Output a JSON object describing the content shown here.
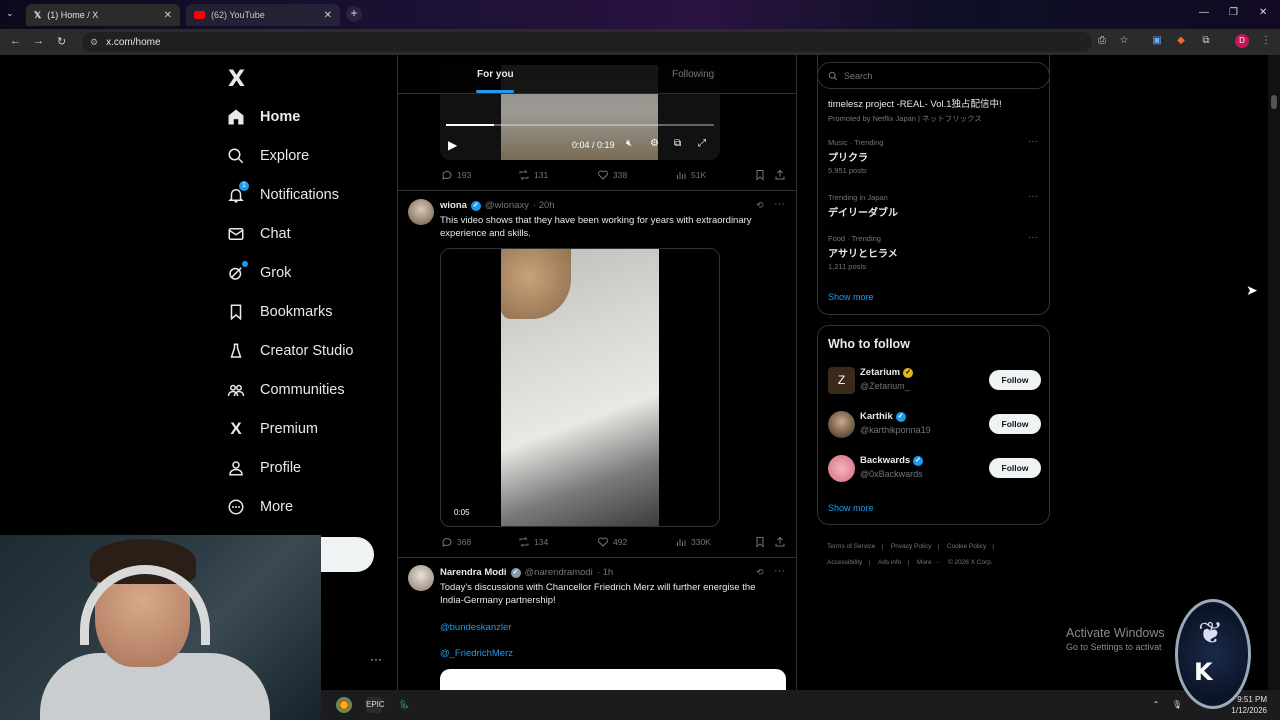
{
  "browser": {
    "tabs": [
      {
        "label": "(1) Home / X",
        "active": true,
        "icon": "x-logo-icon"
      },
      {
        "label": "(62) YouTube",
        "active": false,
        "icon": "youtube-icon"
      }
    ],
    "url": "x.com/home"
  },
  "nav": {
    "logo": "X",
    "items": [
      {
        "label": "Home",
        "icon": "home-icon",
        "bold": true
      },
      {
        "label": "Explore",
        "icon": "search-icon"
      },
      {
        "label": "Notifications",
        "icon": "bell-icon",
        "badge": "1"
      },
      {
        "label": "Chat",
        "icon": "mail-icon"
      },
      {
        "label": "Grok",
        "icon": "grok-icon"
      },
      {
        "label": "Bookmarks",
        "icon": "bookmark-icon"
      },
      {
        "label": "Creator Studio",
        "icon": "creator-icon"
      },
      {
        "label": "Communities",
        "icon": "communities-icon"
      },
      {
        "label": "Premium",
        "icon": "x-premium-icon"
      },
      {
        "label": "Profile",
        "icon": "person-icon"
      },
      {
        "label": "More",
        "icon": "more-circle-icon"
      }
    ]
  },
  "feed": {
    "tabs": {
      "for_you": "For you",
      "following": "Following"
    },
    "post0": {
      "time_display": "0:04 / 0:19",
      "replies": "193",
      "reposts": "131",
      "likes": "338",
      "views": "51K"
    },
    "post1": {
      "name": "wiona",
      "handle": "@wionaxy",
      "time": "· 20h",
      "text": "This video shows that they have been working for years with extraordinary experience and skills.",
      "video_time": "0:05",
      "replies": "368",
      "reposts": "134",
      "likes": "492",
      "views": "330K"
    },
    "post2": {
      "name": "Narendra Modi",
      "handle": "@narendramodi",
      "time": "· 1h",
      "text": "Today's discussions with Chancellor Friedrich Merz will further energise the India-Germany partnership!",
      "mention1": "@bundeskanzler",
      "mention2": "@_FriedrichMerz"
    }
  },
  "right": {
    "search_placeholder": "Search",
    "promo": {
      "title": "timelesz project -REAL- Vol.1独占配信中!",
      "meta": "Promoted by Netflix Japan | ネットフリックス"
    },
    "trends": [
      {
        "meta": "Music · Trending",
        "title": "プリクラ",
        "posts": "5,951 posts"
      },
      {
        "meta": "Trending in Japan",
        "title": "デイリーダブル",
        "posts": ""
      },
      {
        "meta": "Food · Trending",
        "title": "アサリとヒラメ",
        "posts": "1,211 posts"
      }
    ],
    "show_more": "Show more",
    "who_to_follow": {
      "title": "Who to follow",
      "accounts": [
        {
          "name": "Zetarium",
          "handle": "@Zetarium_",
          "verified": "gold"
        },
        {
          "name": "Karthik",
          "handle": "@karthikponna19",
          "verified": "blue"
        },
        {
          "name": "Backwards",
          "handle": "@0xBackwards",
          "verified": "blue"
        }
      ],
      "follow_label": "Follow",
      "show_more": "Show more"
    },
    "footer": [
      "Terms of Service",
      "Privacy Policy",
      "Cookie Policy",
      "Accessibility",
      "Ads info",
      "More ···",
      "© 2026 X Corp."
    ]
  },
  "system": {
    "activate_title": "Activate Windows",
    "activate_sub": "Go to Settings to activat",
    "time": "9:51 PM",
    "date": "1/12/2026"
  }
}
